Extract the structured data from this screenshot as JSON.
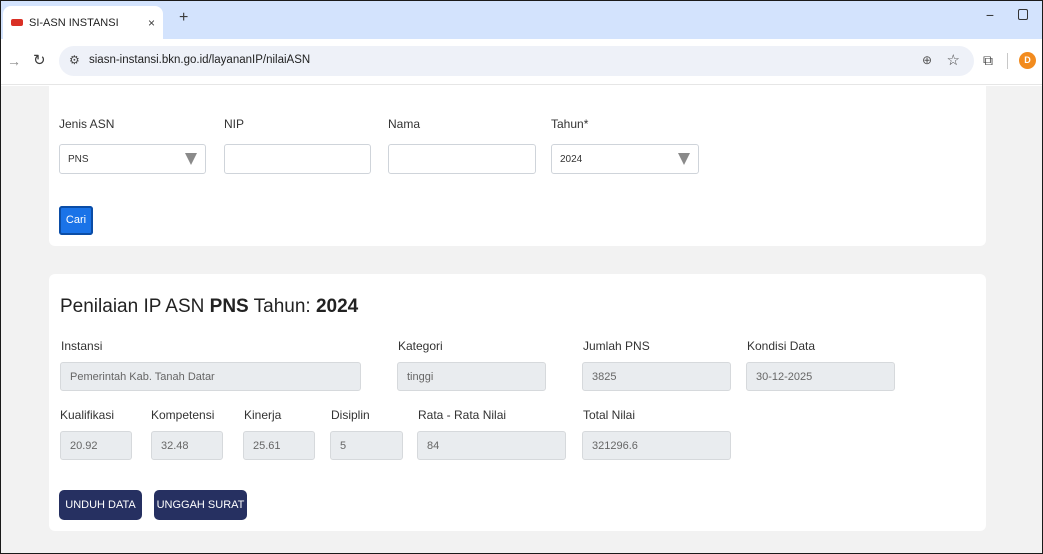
{
  "browser": {
    "tab_title": "SI-ASN INSTANSI",
    "tab_close": "×",
    "new_tab": "+",
    "url": "siasn-instansi.bkn.go.id/layananIP/nilaiASN",
    "profile_initial": "D"
  },
  "filter": {
    "jenis_label": "Jenis ASN",
    "jenis_value": "PNS",
    "nip_label": "NIP",
    "nip_value": "",
    "nama_label": "Nama",
    "nama_value": "",
    "tahun_label": "Tahun*",
    "tahun_value": "2024",
    "search_button": "Cari"
  },
  "result": {
    "heading_prefix": "Penilaian IP ASN ",
    "heading_jenis": "PNS",
    "heading_mid": " Tahun: ",
    "heading_year": "2024",
    "instansi_label": "Instansi",
    "instansi_value": "Pemerintah Kab. Tanah Datar",
    "kategori_label": "Kategori",
    "kategori_value": "tinggi",
    "jumlah_label": "Jumlah PNS",
    "jumlah_value": "3825",
    "kondisi_label": "Kondisi Data",
    "kondisi_value": "30-12-2025",
    "kualifikasi_label": "Kualifikasi",
    "kualifikasi_value": "20.92",
    "kompetensi_label": "Kompetensi",
    "kompetensi_value": "32.48",
    "kinerja_label": "Kinerja",
    "kinerja_value": "25.61",
    "disiplin_label": "Disiplin",
    "disiplin_value": "5",
    "rata_label": "Rata - Rata Nilai",
    "rata_value": "84",
    "total_label": "Total Nilai",
    "total_value": "321296.6",
    "unduh_button": "UNDUH DATA",
    "unggah_button": "UNGGAH SURAT"
  },
  "colors": {
    "primary_button": "#1a73e8",
    "dark_button": "#263061",
    "tab_strip": "#d3e3fd"
  }
}
